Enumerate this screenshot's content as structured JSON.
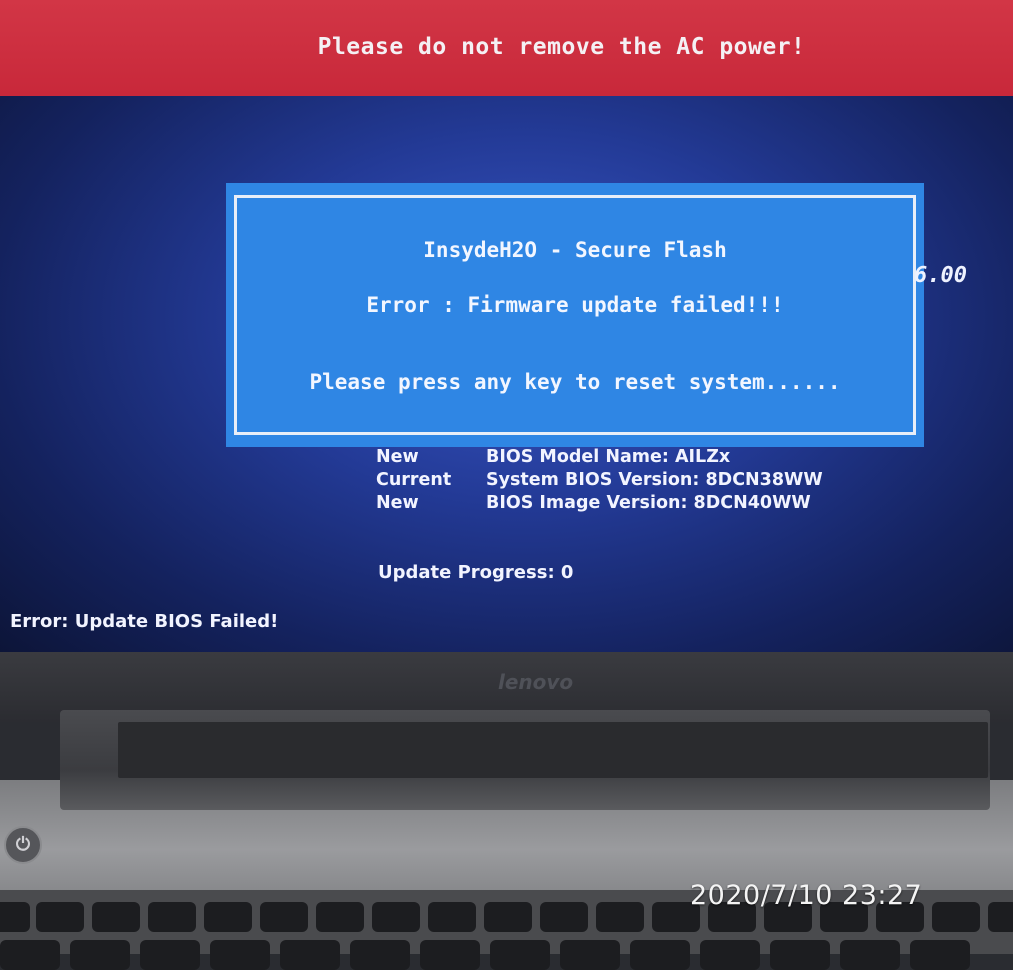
{
  "banner": {
    "text": "Please do not remove the AC power!"
  },
  "dialog": {
    "title": "InsydeH2O - Secure Flash",
    "error": "Error : Firmware update failed!!!",
    "prompt": "Please press any key to reset system......"
  },
  "side_version": "6.00",
  "bios_info": [
    {
      "prefix": "New",
      "text": "BIOS Model Name: AILZx"
    },
    {
      "prefix": "Current",
      "text": "System BIOS Version: 8DCN38WW"
    },
    {
      "prefix": "New",
      "text": "BIOS  Image Version: 8DCN40WW"
    }
  ],
  "progress": "Update Progress: 0",
  "error_line": "Error: Update BIOS Failed!",
  "bezel_logo": "lenovo",
  "timestamp": "2020/7/10  23:27",
  "colors": {
    "banner": "#c8283a",
    "dialog": "#2f86e4",
    "screen_bg": "#233a96"
  }
}
